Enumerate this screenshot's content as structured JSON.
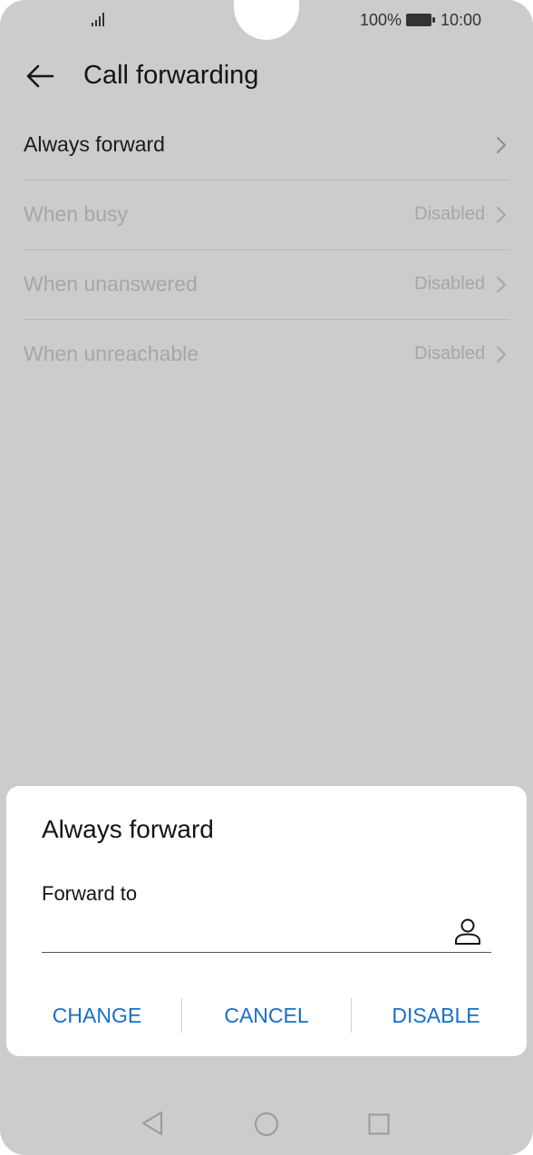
{
  "status_bar": {
    "signal_icon": "signal-icon",
    "battery_percent": "100%",
    "battery_icon": "battery-icon",
    "time": "10:00"
  },
  "app_bar": {
    "back_icon": "back-arrow-icon",
    "title": "Call forwarding"
  },
  "forwarding_options": [
    {
      "label": "Always forward",
      "status": "",
      "enabled": true
    },
    {
      "label": "When busy",
      "status": "Disabled",
      "enabled": false
    },
    {
      "label": "When unanswered",
      "status": "Disabled",
      "enabled": false
    },
    {
      "label": "When unreachable",
      "status": "Disabled",
      "enabled": false
    }
  ],
  "dialog": {
    "title": "Always forward",
    "field_label": "Forward to",
    "field_value": "",
    "contact_icon": "contact-person-icon",
    "actions": {
      "change": "CHANGE",
      "cancel": "CANCEL",
      "disable": "DISABLE"
    }
  },
  "nav_bar": {
    "back": "nav-back-icon",
    "home": "nav-home-icon",
    "recents": "nav-recents-icon"
  },
  "colors": {
    "accent": "#1a6fc4",
    "scrim_background": "#cccccc",
    "disabled_text": "#a6a6a6"
  }
}
